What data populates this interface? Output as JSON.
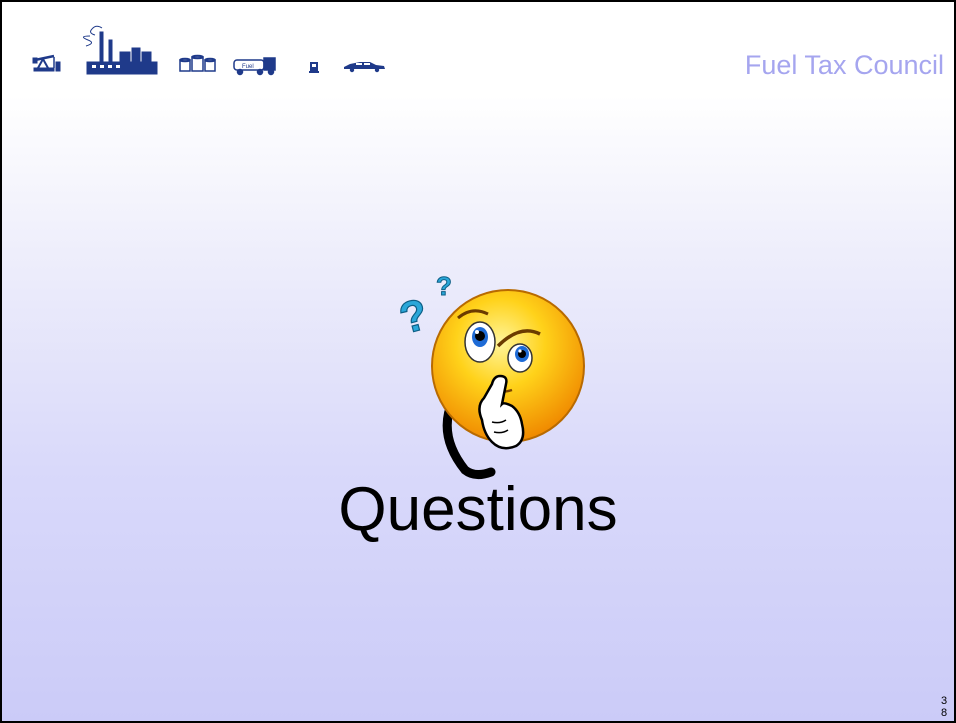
{
  "header": {
    "org_name": "Fuel Tax Council",
    "icons": [
      "oil-pump-icon",
      "refinery-icon",
      "storage-tanks-icon",
      "fuel-truck-icon",
      "fuel-pump-icon",
      "car-icon"
    ],
    "truck_label": "Fuel"
  },
  "main": {
    "title": "Questions",
    "image": "thinking-smiley-icon"
  },
  "footer": {
    "page_number": "38"
  },
  "colors": {
    "accent_text": "#a5a5ef",
    "icon_blue": "#1f3a8a",
    "background_bottom": "#cbcbf8"
  }
}
